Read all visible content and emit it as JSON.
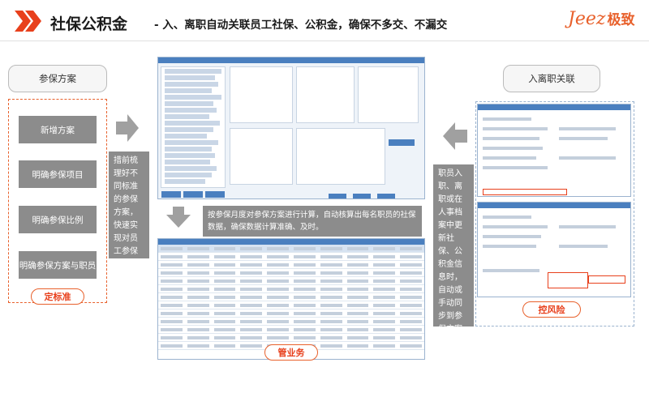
{
  "header": {
    "title": "社保公积金",
    "subtitle": "- 入、离职自动关联员工社保、公积金，确保不多交、不漏交",
    "logo_text": "Jeez",
    "logo_cn": "极致",
    "accent_color": "#e8612c"
  },
  "left": {
    "heading": "参保方案",
    "buttons": [
      "新增方案",
      "明确参保项目",
      "明确参保比例",
      "明确参保方案与职员"
    ],
    "tag": "定标准",
    "note": "措前梳理好不同标准的参保方案，快速实现对员工参保的统一管理。"
  },
  "middle": {
    "note": "按参保月度对参保方案进行计算，自动核算出每名职员的社保数据，确保数据计算准确、及时。",
    "tag": "管业务"
  },
  "right": {
    "heading": "入离职关联",
    "note": "职员入职、离职或在人事档案中更新社保、公积金信息时，自动或手动同步到参保方案中，确保不多交、不漏交、规避风险。",
    "tag": "控风险"
  }
}
